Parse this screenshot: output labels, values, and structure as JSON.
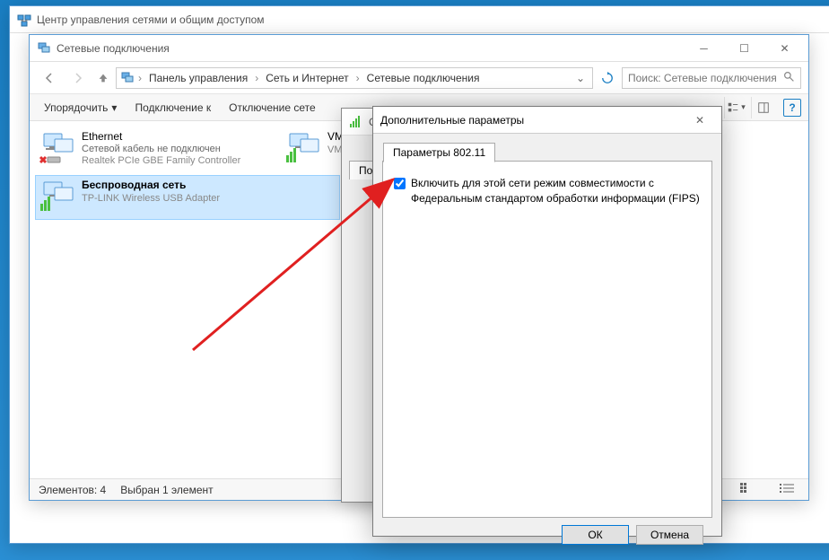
{
  "win1": {
    "title": "Центр управления сетями и общим доступом"
  },
  "win2": {
    "title": "Сетевые подключения",
    "breadcrumb": [
      "Панель управления",
      "Сеть и Интернет",
      "Сетевые подключения"
    ],
    "search_placeholder": "Поиск: Сетевые подключения",
    "toolbar": {
      "organize": "Упорядочить",
      "connect": "Подключение к",
      "disable": "Отключение сете"
    },
    "items": [
      {
        "name": "Ethernet",
        "status": "Сетевой кабель не подключен",
        "device": "Realtek PCIe GBE Family Controller",
        "disconnected": true
      },
      {
        "name": "VMw",
        "status": "",
        "device": "VMw",
        "disconnected": false
      },
      {
        "name": "Беспроводная сеть",
        "status": "",
        "device": "TP-LINK Wireless USB Adapter",
        "disconnected": false,
        "selected": true
      }
    ],
    "status": {
      "count": "Элементов: 4",
      "selected": "Выбран 1 элемент"
    }
  },
  "win3": {
    "title": "Сво",
    "tab": "Под"
  },
  "win4": {
    "title": "Дополнительные параметры",
    "tab": "Параметры 802.11",
    "checkbox_label": "Включить для этой сети режим совместимости с Федеральным стандартом обработки информации (FIPS)",
    "ok": "ОК",
    "cancel": "Отмена"
  }
}
